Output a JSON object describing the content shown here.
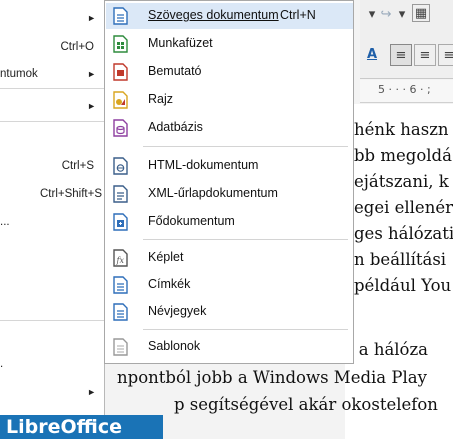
{
  "left_menu": {
    "items": [
      {
        "label": "",
        "shortcut": "",
        "arrow": "►"
      },
      {
        "label": "",
        "shortcut": "Ctrl+O",
        "arrow": ""
      },
      {
        "label": "ntumok",
        "shortcut": "",
        "arrow": "►"
      },
      {
        "label": "",
        "shortcut": "",
        "arrow": "►"
      },
      {
        "label": "",
        "shortcut": "Ctrl+S",
        "arrow": ""
      },
      {
        "label": "",
        "shortcut": "Ctrl+Shift+S",
        "arrow": ""
      },
      {
        "label": "...",
        "shortcut": "",
        "arrow": ""
      },
      {
        "label": ".",
        "shortcut": "",
        "arrow": ""
      },
      {
        "label": "",
        "shortcut": "",
        "arrow": "►"
      }
    ]
  },
  "submenu": {
    "items": [
      {
        "label": "Szöveges dokumentum",
        "shortcut": "Ctrl+N",
        "icon": "writer-doc-icon",
        "color": "#2f6fba"
      },
      {
        "label": "Munkafüzet",
        "shortcut": "",
        "icon": "calc-spreadsheet-icon",
        "color": "#2e8b3d"
      },
      {
        "label": "Bemutató",
        "shortcut": "",
        "icon": "impress-presentation-icon",
        "color": "#c0392b"
      },
      {
        "label": "Rajz",
        "shortcut": "",
        "icon": "draw-drawing-icon",
        "color": "#d9a520"
      },
      {
        "label": "Adatbázis",
        "shortcut": "",
        "icon": "base-database-icon",
        "color": "#8e3fa0"
      },
      {
        "label": "HTML-dokumentum",
        "shortcut": "",
        "icon": "html-document-icon",
        "color": "#3b5f8a"
      },
      {
        "label": "XML-űrlapdokumentum",
        "shortcut": "",
        "icon": "xml-form-document-icon",
        "color": "#3b5f8a"
      },
      {
        "label": "Fődokumentum",
        "shortcut": "",
        "icon": "master-document-icon",
        "color": "#2f6fba"
      },
      {
        "label": "Képlet",
        "shortcut": "",
        "icon": "math-formula-icon",
        "color": "#555555"
      },
      {
        "label": "Címkék",
        "shortcut": "",
        "icon": "labels-icon",
        "color": "#2f6fba"
      },
      {
        "label": "Névjegyek",
        "shortcut": "",
        "icon": "business-cards-icon",
        "color": "#2f6fba"
      },
      {
        "label": "Sablonok",
        "shortcut": "",
        "icon": "templates-icon",
        "color": "#999999"
      }
    ]
  },
  "document": {
    "lines": [
      "hénk haszn",
      "bb megoldá",
      "ejátszani, k",
      "egei ellenér",
      "ges hálózati",
      "n beállítási",
      "például You",
      "hálózati eszközökre a hálóza",
      "npontból jobb a Windows Media Play",
      "p segítségével akár okostelefon"
    ],
    "ruler": "5 · · · 6 · ;"
  },
  "logo": {
    "text": "LibreOffice"
  },
  "colors": {
    "highlight": "#dbe8f7",
    "logo_bg": "#1a73b6"
  }
}
